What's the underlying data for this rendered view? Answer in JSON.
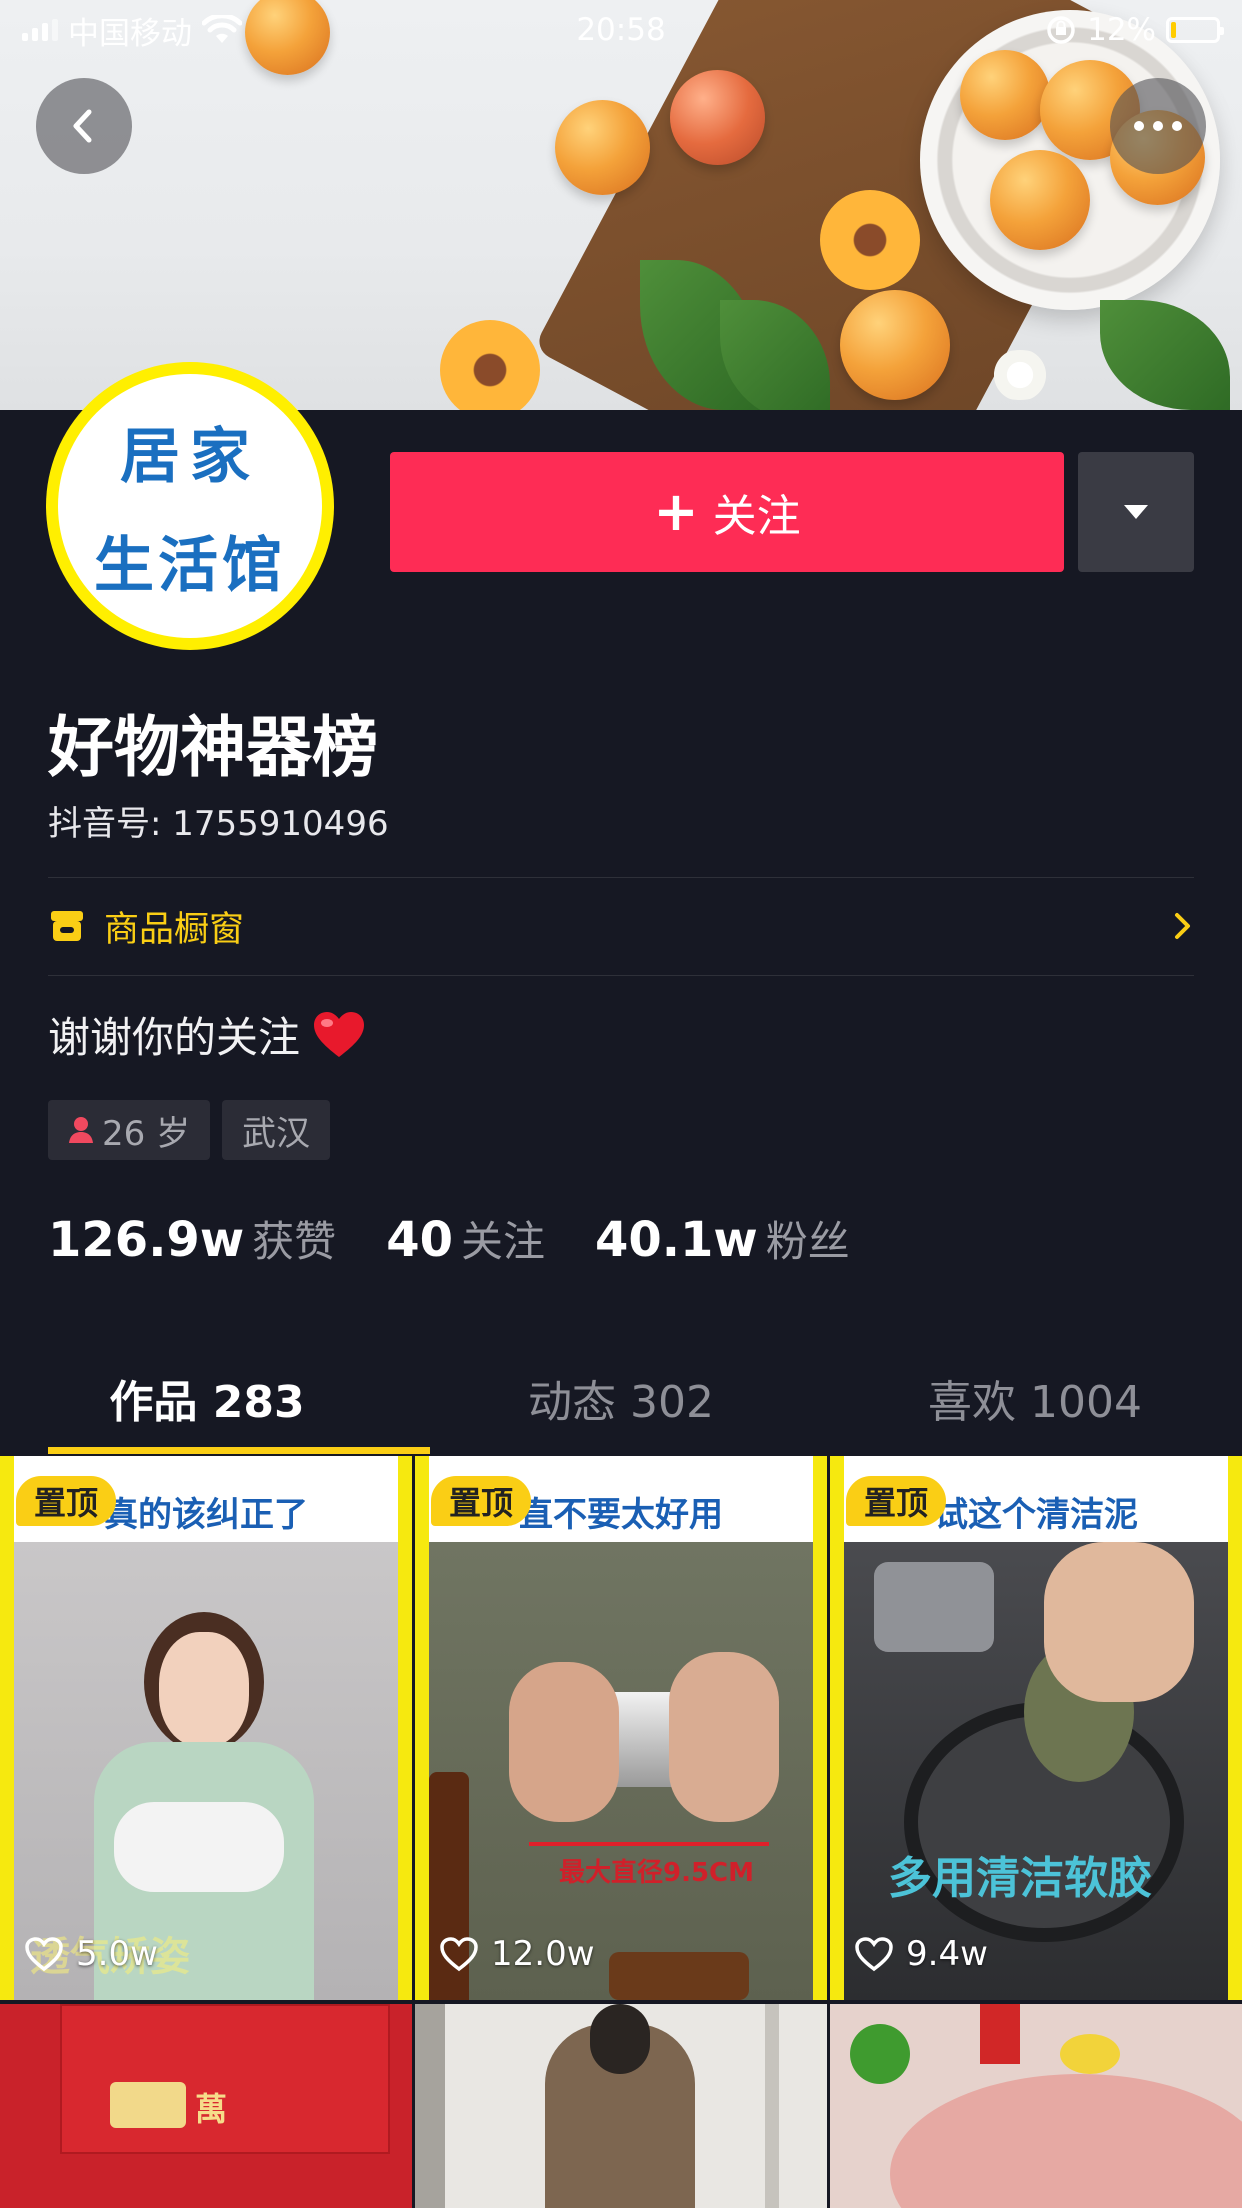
{
  "status_bar": {
    "carrier": "中国移动",
    "time": "20:58",
    "battery_percent": "12%",
    "battery_level": 0.12
  },
  "profile": {
    "avatar_text_line1": "居家",
    "avatar_text_line2": "生活馆",
    "follow_label": "关注",
    "name": "好物神器榜",
    "douyin_id": "抖音号: 1755910496",
    "shop_label": "商品橱窗",
    "bio": "谢谢你的关注",
    "bio_emoji": "❤️",
    "tags": {
      "age": "26 岁",
      "city": "武汉"
    },
    "stats": {
      "likes_num": "126.9w",
      "likes_label": "获赞",
      "following_num": "40",
      "following_label": "关注",
      "fans_num": "40.1w",
      "fans_label": "粉丝"
    }
  },
  "tabs": [
    {
      "label": "作品 283",
      "active": true
    },
    {
      "label": "动态 302",
      "active": false
    },
    {
      "label": "喜欢 1004",
      "active": false
    }
  ],
  "videos": [
    {
      "pinned_label": "置顶",
      "likes": "5.0w",
      "caption": "真的该纠正了",
      "overlay": "透气矫姿"
    },
    {
      "pinned_label": "置顶",
      "likes": "12.0w",
      "caption": "直不要太好用",
      "overlay": "最大直径9.5CM"
    },
    {
      "pinned_label": "置顶",
      "likes": "9.4w",
      "caption": "试这个清洁泥",
      "overlay": "多用清洁软胶"
    },
    {
      "overlay": "萬"
    }
  ],
  "colors": {
    "bg": "#161823",
    "accent_red": "#fe2c55",
    "accent_yellow": "#face15",
    "avatar_ring": "#ffef00"
  }
}
